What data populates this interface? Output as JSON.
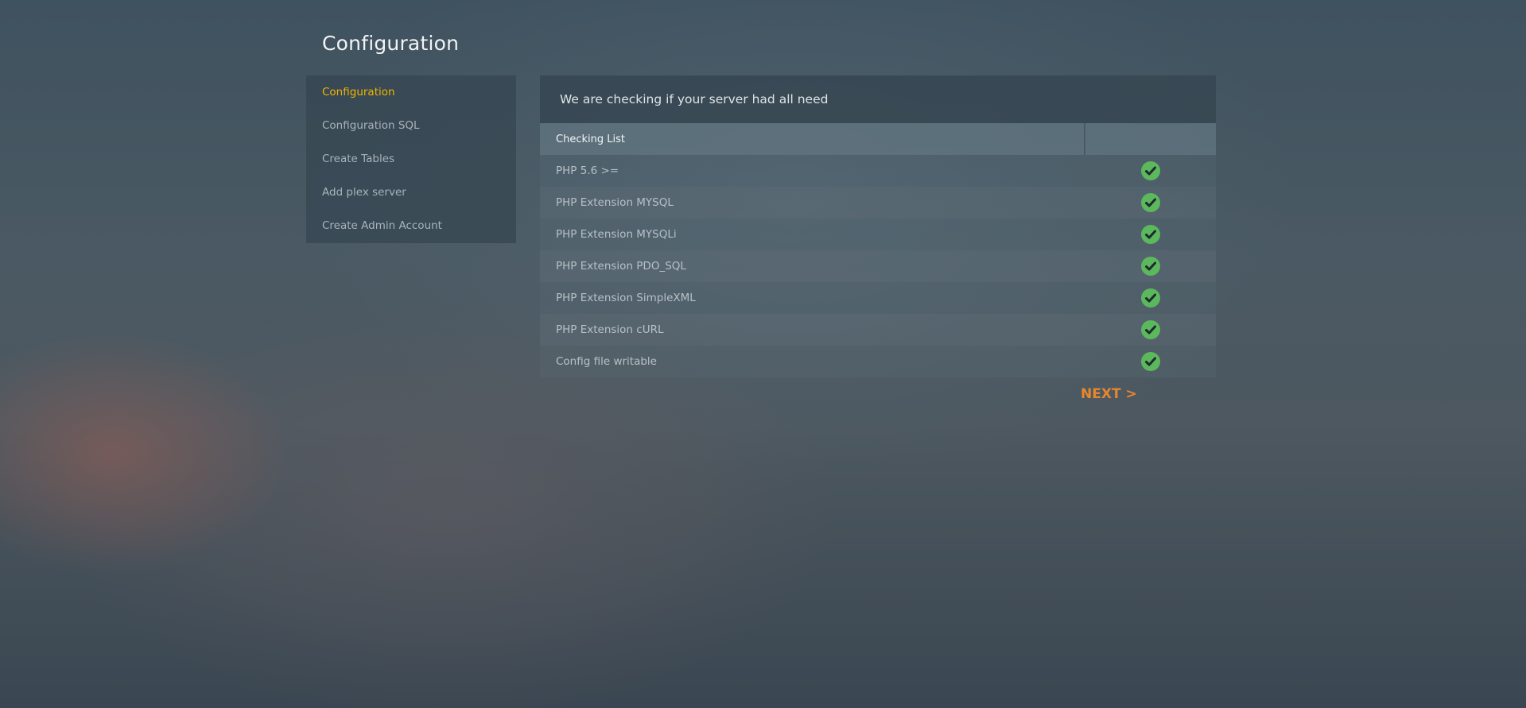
{
  "page": {
    "title": "Configuration"
  },
  "sidebar": {
    "items": [
      {
        "label": "Configuration",
        "active": true
      },
      {
        "label": "Configuration SQL",
        "active": false
      },
      {
        "label": "Create Tables",
        "active": false
      },
      {
        "label": "Add plex server",
        "active": false
      },
      {
        "label": "Create Admin Account",
        "active": false
      }
    ]
  },
  "panel": {
    "header": "We are checking if your server had all need",
    "table": {
      "columns": [
        "Checking List",
        ""
      ],
      "rows": [
        {
          "label": "PHP 5.6 >=",
          "status": "check-icon"
        },
        {
          "label": "PHP Extension MYSQL",
          "status": "check-icon"
        },
        {
          "label": "PHP Extension MYSQLi",
          "status": "check-icon"
        },
        {
          "label": "PHP Extension PDO_SQL",
          "status": "check-icon"
        },
        {
          "label": "PHP Extension SimpleXML",
          "status": "check-icon"
        },
        {
          "label": "PHP Extension cURL",
          "status": "check-icon"
        },
        {
          "label": "Config file writable",
          "status": "check-icon"
        }
      ]
    }
  },
  "next_button": {
    "label": "NEXT >"
  },
  "colors": {
    "active_nav": "#f0b400",
    "next_link": "#e7862c",
    "check_fill": "#5cb85c"
  }
}
